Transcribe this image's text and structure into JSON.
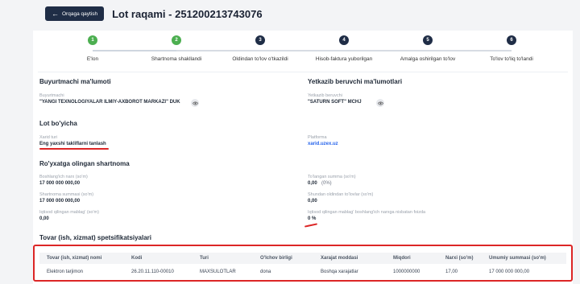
{
  "header": {
    "back_label": "Orqaga qaytish",
    "title": "Lot raqami - 251200213743076"
  },
  "steps": [
    {
      "num": "1",
      "label": "E'lon",
      "status": "done"
    },
    {
      "num": "2",
      "label": "Shartnoma shakllandi",
      "status": "done"
    },
    {
      "num": "3",
      "label": "Oldindan to'lov o'tkazildi",
      "status": "pending"
    },
    {
      "num": "4",
      "label": "Hisob-faktura yuborilgan",
      "status": "pending"
    },
    {
      "num": "5",
      "label": "Amalga oshirilgan to'lov",
      "status": "pending"
    },
    {
      "num": "6",
      "label": "To'lov to'liq to'landi",
      "status": "pending"
    }
  ],
  "buyer": {
    "section_title": "Buyurtmachi ma'lumoti",
    "label": "Buyurtmachi",
    "value": "\"YANGI TEXNOLOGIYALAR ILMIY-AXBOROT MARKAZI\" DUK"
  },
  "supplier": {
    "section_title": "Yetkazib beruvchi ma'lumotlari",
    "label": "Yetkazib beruvchi",
    "value": "\"SATURN SOFT\" MCHJ"
  },
  "lot": {
    "section_title": "Lot bo'yicha",
    "type_label": "Xarid turi",
    "type_value": "Eng yaxshi takliflarni tanlash",
    "platform_label": "Platforma",
    "platform_value": "xarid.uzex.uz"
  },
  "contract": {
    "section_title": "Ro'yxatga olingan shartnoma",
    "start_price_label": "Boshlang'ich narx (so'm)",
    "start_price_value": "17 000 000 000,00",
    "paid_label": "To'langan summa (so'm)",
    "paid_value": "0,00",
    "paid_pct": "(0%)",
    "contract_sum_label": "Shartnoma summasi (so'm)",
    "contract_sum_value": "17 000 000 000,00",
    "prepaid_label": "Shundan oldindan to'lovlar (so'm)",
    "prepaid_value": "0,00",
    "saved_label": "Iqtisod qilingan mablag' (so'm)",
    "saved_value": "0,00",
    "saved_pct_label": "Iqtisod qilingan mablag' boshlang'ich narxga nisbatan foizda",
    "saved_pct_value": "0 %"
  },
  "specs": {
    "section_title": "Tovar (ish, xizmat) spetsifikatsiyalari",
    "columns": [
      "Tovar (ish, xizmat) nomi",
      "Kodi",
      "Turi",
      "O'lchov birligi",
      "Xarajat moddasi",
      "Miqdori",
      "Narxi (so'm)",
      "Umumiy summasi (so'm)"
    ],
    "rows": [
      [
        "Elektron tarjimon",
        "26.20.11.110-00010",
        "MAXSULOTLAR",
        "dona",
        "Boshqa xarajatlar",
        "1000000000",
        "17,00",
        "17 000 000 000,00"
      ]
    ]
  },
  "colors": {
    "done_step": "#4caf50",
    "pending_step": "#1f2d46",
    "highlight": "#dc2626",
    "link": "#2563eb"
  }
}
